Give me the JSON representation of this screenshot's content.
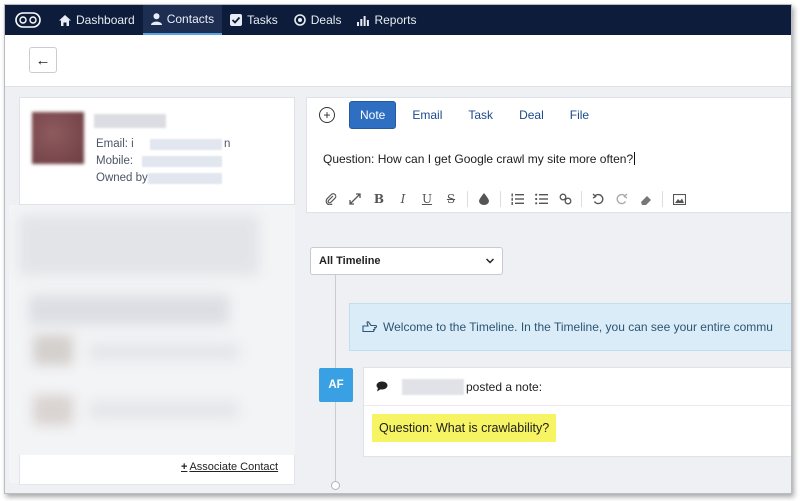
{
  "nav": {
    "logo_icon": "infinity-logo-icon",
    "items": [
      {
        "label": "Dashboard",
        "icon": "home-icon"
      },
      {
        "label": "Contacts",
        "icon": "user-icon"
      },
      {
        "label": "Tasks",
        "icon": "checkbox-icon"
      },
      {
        "label": "Deals",
        "icon": "target-icon"
      },
      {
        "label": "Reports",
        "icon": "bar-chart-icon"
      }
    ],
    "active": "Contacts"
  },
  "subbar": {
    "back_icon": "←"
  },
  "contact": {
    "email_label": "Email: i",
    "email_suffix": "n",
    "mobile_label": "Mobile:",
    "owned_label": "Owned by"
  },
  "associate": {
    "plus": "+",
    "label": "Associate Contact"
  },
  "composer": {
    "add_icon": "+",
    "tabs": [
      "Note",
      "Email",
      "Task",
      "Deal",
      "File"
    ],
    "active_tab": "Note",
    "text": "Question: How can I get Google crawl my site more often?"
  },
  "timeline": {
    "filter_value": "All Timeline",
    "welcome_text": "Welcome to the Timeline. In the Timeline, you can see your entire commu",
    "entry": {
      "initials": "AF",
      "action": "posted a note:",
      "body": "Question: What is crawlability?"
    }
  },
  "colors": {
    "nav_bg": "#0d1c3a",
    "accent": "#2f6fc2",
    "badge": "#3aa0e4",
    "highlight": "#f7f463"
  }
}
